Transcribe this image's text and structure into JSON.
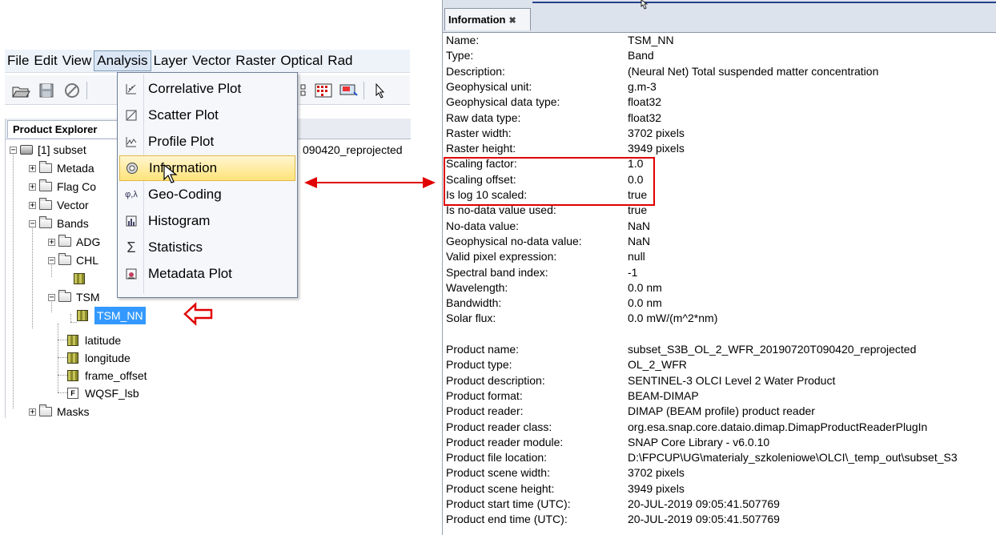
{
  "menubar": {
    "items": [
      "File",
      "Edit",
      "View",
      "Analysis",
      "Layer",
      "Vector",
      "Raster",
      "Optical",
      "Rad"
    ]
  },
  "explorer": {
    "tab_label": "Product Explorer",
    "product_label": "[1] subset",
    "product_suffix": "090420_reprojected",
    "nodes": {
      "metadata": "Metada",
      "flag_codings": "Flag Co",
      "vector": "Vector",
      "bands": "Bands",
      "adg": "ADG",
      "chl": "CHL",
      "tsm": "TSM",
      "tsm_nn": "TSM_NN",
      "latitude": "latitude",
      "longitude": "longitude",
      "frame_offset": "frame_offset",
      "wqsf_lsb": "WQSF_lsb",
      "masks": "Masks"
    }
  },
  "analysis_menu": {
    "items": [
      {
        "label": "Correlative Plot",
        "icon": "correlative-plot-icon"
      },
      {
        "label": "Scatter Plot",
        "icon": "scatter-plot-icon"
      },
      {
        "label": "Profile Plot",
        "icon": "profile-plot-icon"
      },
      {
        "label": "Information",
        "icon": "information-icon"
      },
      {
        "label": "Geo-Coding",
        "icon": "geo-coding-icon"
      },
      {
        "label": "Histogram",
        "icon": "histogram-icon"
      },
      {
        "label": "Statistics",
        "icon": "statistics-icon"
      },
      {
        "label": "Metadata Plot",
        "icon": "metadata-plot-icon"
      }
    ],
    "highlighted": "Information"
  },
  "info_panel": {
    "tab_label": "Information",
    "rows": [
      {
        "k": "Name:",
        "v": "TSM_NN"
      },
      {
        "k": "Type:",
        "v": "Band"
      },
      {
        "k": "Description:",
        "v": "(Neural Net) Total suspended matter concentration"
      },
      {
        "k": "Geophysical unit:",
        "v": "g.m-3"
      },
      {
        "k": "Geophysical data type:",
        "v": "float32"
      },
      {
        "k": "Raw data type:",
        "v": "float32"
      },
      {
        "k": "Raster width:",
        "v": "3702 pixels"
      },
      {
        "k": "Raster height:",
        "v": "3949 pixels"
      },
      {
        "k": "Scaling factor:",
        "v": "1.0"
      },
      {
        "k": "Scaling offset:",
        "v": "0.0"
      },
      {
        "k": "Is log 10 scaled:",
        "v": "true"
      },
      {
        "k": "Is no-data value used:",
        "v": "true"
      },
      {
        "k": "No-data value:",
        "v": "NaN"
      },
      {
        "k": "Geophysical no-data value:",
        "v": "NaN"
      },
      {
        "k": "Valid pixel expression:",
        "v": "null"
      },
      {
        "k": "Spectral band index:",
        "v": "-1"
      },
      {
        "k": "Wavelength:",
        "v": "0.0 nm"
      },
      {
        "k": "Bandwidth:",
        "v": "0.0 nm"
      },
      {
        "k": "Solar flux:",
        "v": "0.0 mW/(m^2*nm)"
      },
      {
        "k": "",
        "v": ""
      },
      {
        "k": "Product name:",
        "v": "subset_S3B_OL_2_WFR_20190720T090420_reprojected"
      },
      {
        "k": "Product type:",
        "v": "OL_2_WFR"
      },
      {
        "k": "Product description:",
        "v": "SENTINEL-3 OLCI Level 2 Water Product"
      },
      {
        "k": "Product format:",
        "v": "BEAM-DIMAP"
      },
      {
        "k": "Product reader:",
        "v": "DIMAP (BEAM profile) product reader"
      },
      {
        "k": "Product reader class:",
        "v": "org.esa.snap.core.dataio.dimap.DimapProductReaderPlugIn"
      },
      {
        "k": "Product reader module:",
        "v": "SNAP Core Library - v6.0.10"
      },
      {
        "k": "Product file location:",
        "v": "D:\\FPCUP\\UG\\materialy_szkoleniowe\\OLCI\\_temp_out\\subset_S3"
      },
      {
        "k": "Product scene width:",
        "v": "3702 pixels"
      },
      {
        "k": "Product scene height:",
        "v": "3949 pixels"
      },
      {
        "k": "Product start time (UTC):",
        "v": "20-JUL-2019 09:05:41.507769"
      },
      {
        "k": "Product end time (UTC):",
        "v": "20-JUL-2019 09:05:41.507769"
      }
    ]
  },
  "colors": {
    "annotation_red": "#e00000",
    "selection_blue": "#3399ff",
    "menu_highlight": "#ffe37a"
  }
}
